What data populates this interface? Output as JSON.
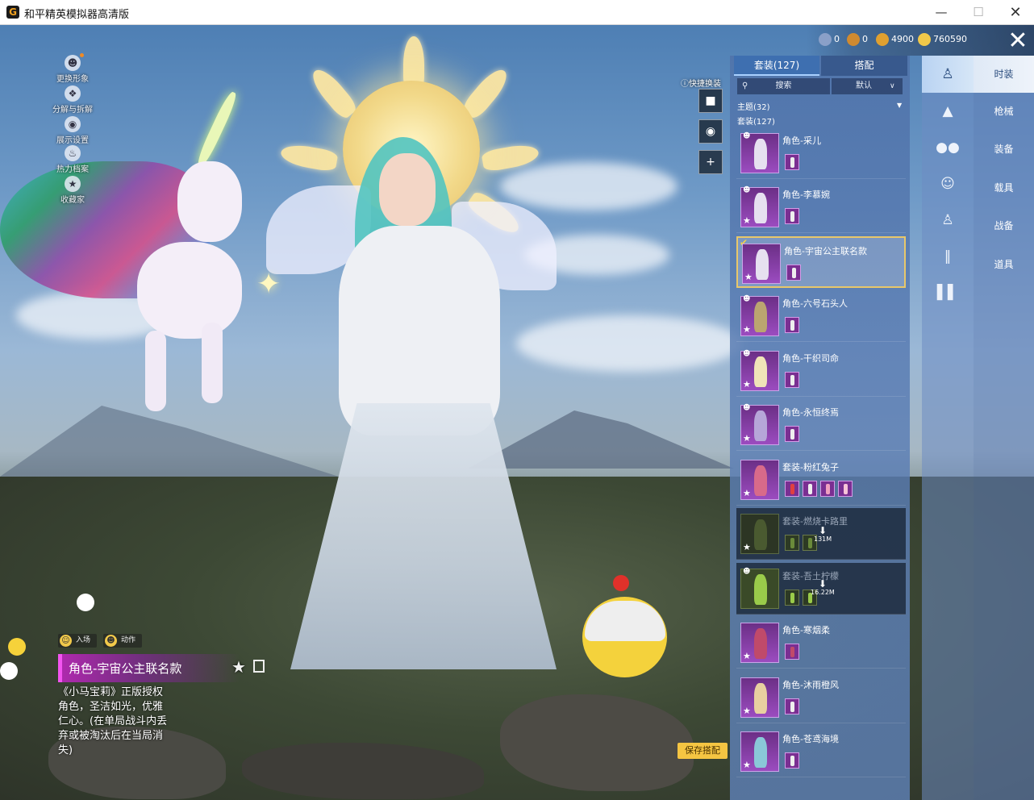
{
  "window": {
    "title": "和平精英模拟器高清版"
  },
  "left_menu": [
    {
      "label": "更换形象"
    },
    {
      "label": "分解与拆解"
    },
    {
      "label": "展示设置"
    },
    {
      "label": "热力档案"
    },
    {
      "label": "收藏家"
    }
  ],
  "currency": [
    {
      "value": "0",
      "color": "#8aa0c8"
    },
    {
      "value": "0",
      "color": "#d08a30"
    },
    {
      "value": "4900",
      "color": "#e0a030"
    },
    {
      "value": "760590",
      "color": "#f0c84a"
    }
  ],
  "quick_change": {
    "label": "快捷换装"
  },
  "panel": {
    "tabs": [
      {
        "label": "套装(127)"
      },
      {
        "label": "搭配"
      }
    ],
    "search_placeholder": "搜索",
    "sort_label": "默认",
    "theme_count": "主题(32)",
    "outfit_count": "套装(127)"
  },
  "outfits": [
    {
      "name": "角色-采儿"
    },
    {
      "name": "角色-李慕婉"
    },
    {
      "name": "角色-宇宙公主联名款"
    },
    {
      "name": "角色-六号石头人"
    },
    {
      "name": "角色-干织司命"
    },
    {
      "name": "角色-永恒终焉"
    },
    {
      "name": "套装-粉红兔子"
    },
    {
      "name": "套装-燃烧卡路里",
      "download": "131M"
    },
    {
      "name": "套装-吾土柠檬",
      "download": "16.22M"
    },
    {
      "name": "角色-寒烟柔"
    },
    {
      "name": "角色-沐雨橙风"
    },
    {
      "name": "角色-苍鸢海境"
    }
  ],
  "categories": [
    "时装",
    "枪械",
    "装备",
    "载具",
    "战备",
    "道具"
  ],
  "cat_icons": [
    "figure-icon",
    "cap-icon",
    "glasses-icon",
    "mask-icon",
    "outfit-icon",
    "pants-icon",
    "shoes-icon"
  ],
  "selected_item": {
    "tags": [
      "入场",
      "动作"
    ],
    "name": "角色-宇宙公主联名款",
    "description": "《小马宝莉》正版授权角色，圣洁如光，优雅仁心。(在单局战斗内丢弃或被淘汰后在当局消失)"
  },
  "save_label": "保存搭配",
  "accent": "#f5c542"
}
